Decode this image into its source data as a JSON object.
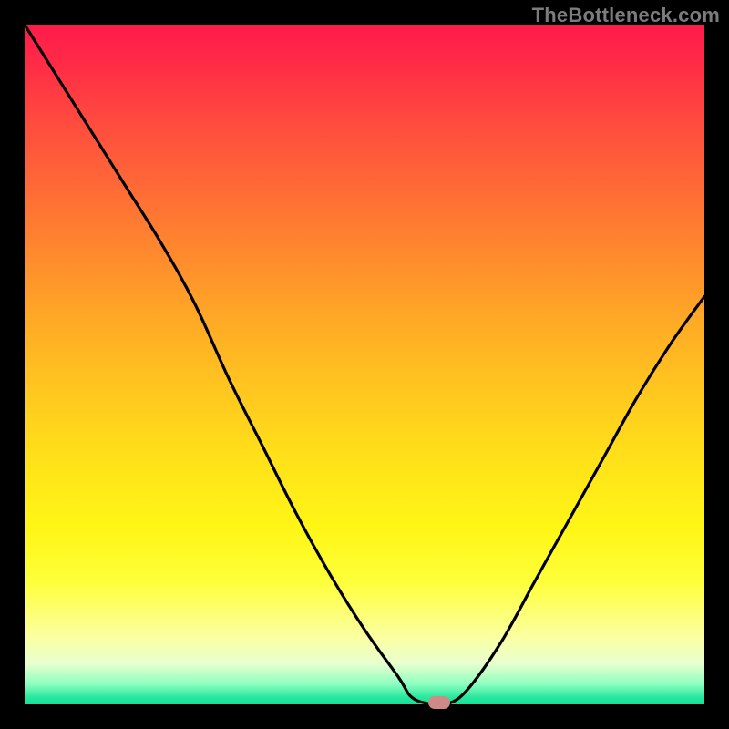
{
  "watermark": "TheBottleneck.com",
  "chart_data": {
    "type": "line",
    "title": "",
    "xlabel": "",
    "ylabel": "",
    "xlim": [
      0,
      100
    ],
    "ylim": [
      0,
      100
    ],
    "grid": false,
    "legend": false,
    "background": "red-yellow-green vertical gradient (high=red, low=green)",
    "series": [
      {
        "name": "bottleneck-curve",
        "x": [
          0,
          5,
          10,
          15,
          20,
          25,
          30,
          35,
          40,
          45,
          50,
          55,
          57,
          60,
          62,
          65,
          70,
          75,
          80,
          85,
          90,
          95,
          100
        ],
        "values": [
          100,
          92,
          84,
          76,
          68,
          59,
          48,
          38,
          28,
          19,
          11,
          4,
          1,
          0,
          0,
          2,
          9,
          18,
          27,
          36,
          45,
          53,
          60
        ]
      }
    ],
    "marker": {
      "x": 61,
      "y": 0,
      "color": "#d08a86"
    }
  },
  "colors": {
    "frame": "#000000",
    "curve": "#000000",
    "marker": "#d08a86",
    "watermark": "#7c7c7c"
  }
}
